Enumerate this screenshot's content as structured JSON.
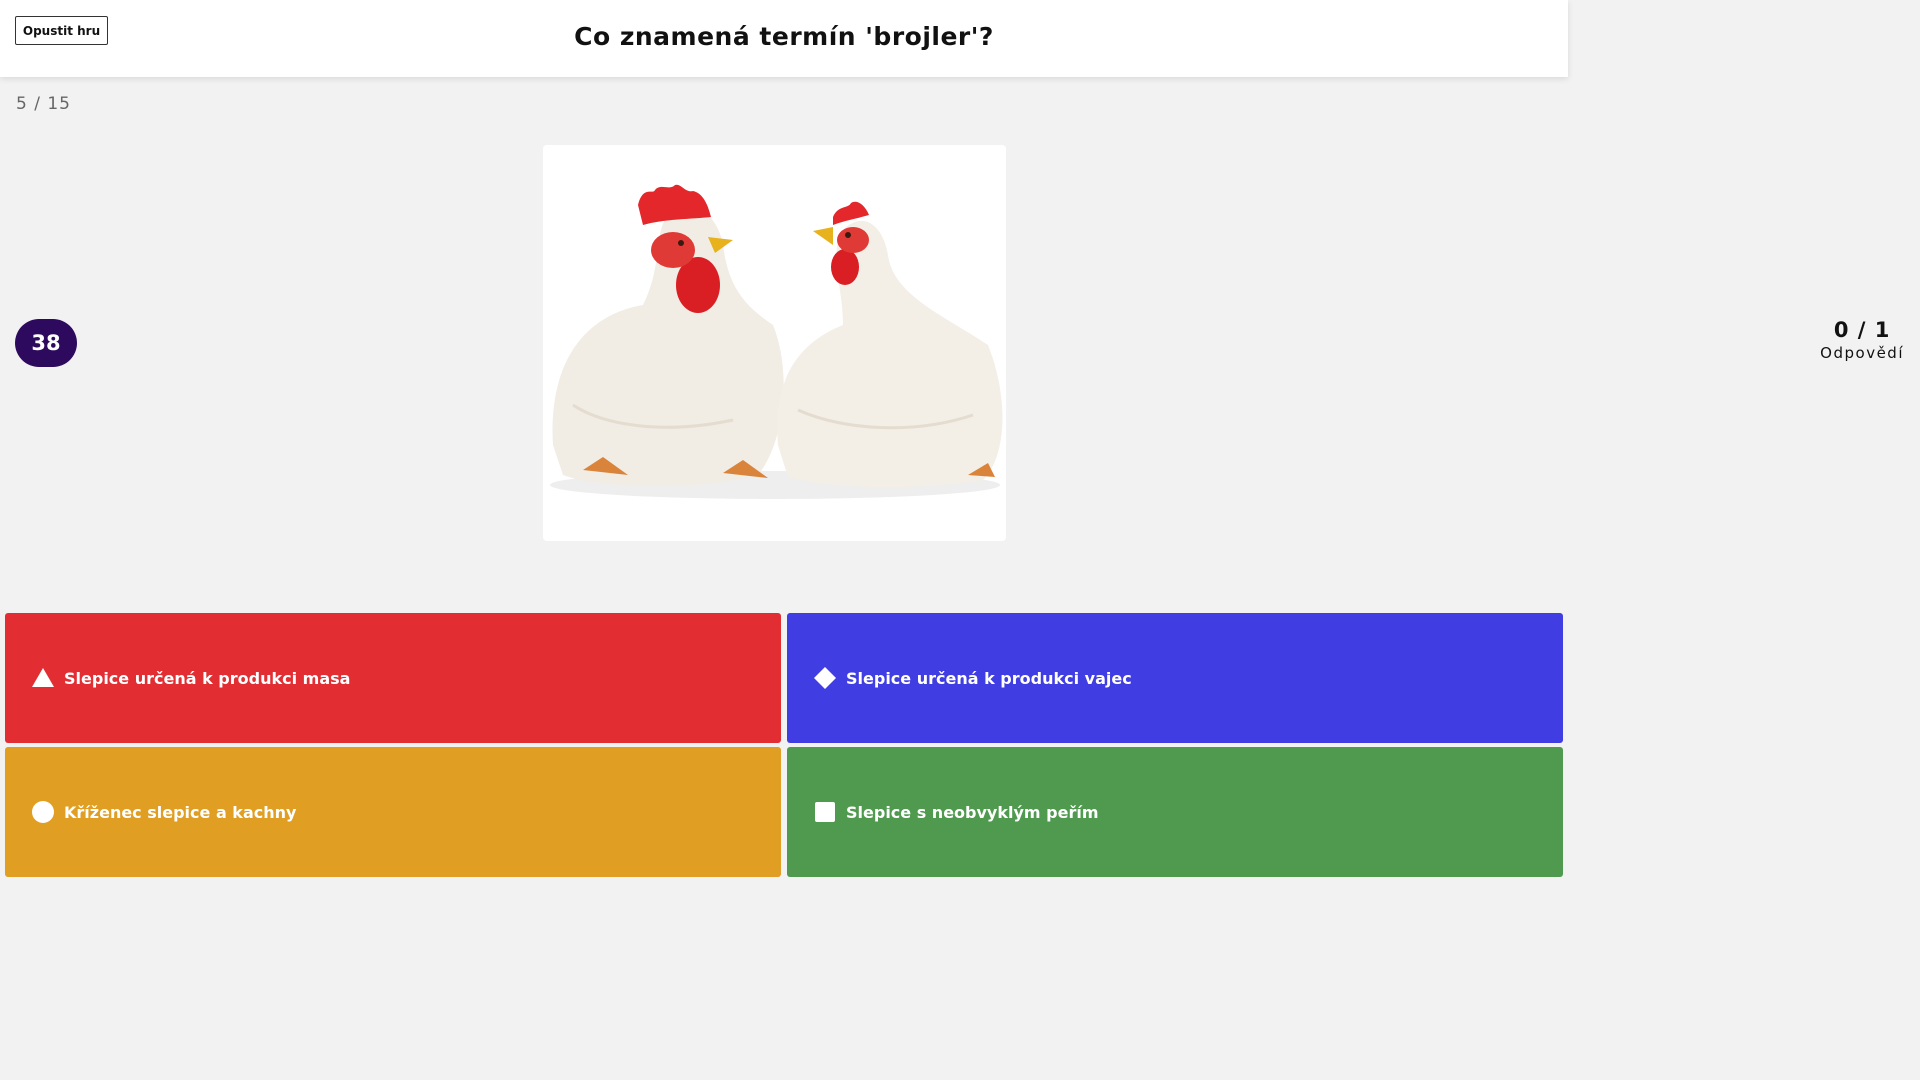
{
  "header": {
    "quit_label": "Opustit hru",
    "question": "Co znamená termín 'brojler'?"
  },
  "progress": "5 / 15",
  "timer": "38",
  "answers_count": {
    "value": "0 / 1",
    "label": "Odpovědí"
  },
  "answers": [
    {
      "label": "Slepice určená k produkci masa",
      "shape": "triangle-icon",
      "color": "#e22e33"
    },
    {
      "label": "Slepice určená k produkci vajec",
      "shape": "diamond-icon",
      "color": "#403de3"
    },
    {
      "label": "Kříženec slepice a kachny",
      "shape": "circle-icon",
      "color": "#e09e22"
    },
    {
      "label": "Slepice s neobvyklým peřím",
      "shape": "square-icon",
      "color": "#4f9a4f"
    }
  ]
}
